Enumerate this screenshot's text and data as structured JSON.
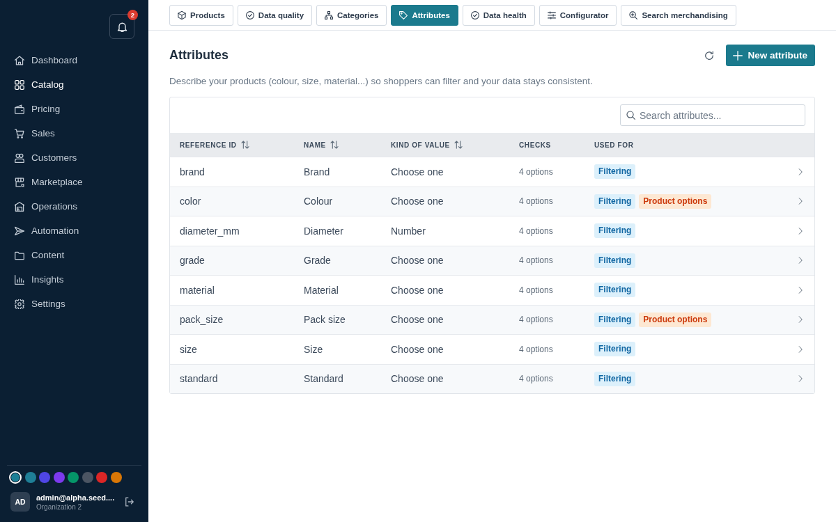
{
  "sidebar": {
    "notifications": {
      "count": "2"
    },
    "nav": [
      {
        "label": "Dashboard",
        "selected": false
      },
      {
        "label": "Catalog",
        "selected": true
      },
      {
        "label": "Pricing",
        "selected": false
      },
      {
        "label": "Sales",
        "selected": false
      },
      {
        "label": "Customers",
        "selected": false
      },
      {
        "label": "Marketplace",
        "selected": false
      },
      {
        "label": "Operations",
        "selected": false
      },
      {
        "label": "Automation",
        "selected": false
      },
      {
        "label": "Content",
        "selected": false
      },
      {
        "label": "Insights",
        "selected": false
      },
      {
        "label": "Settings",
        "selected": false
      }
    ],
    "swatches": [
      {
        "color": "#1d7f96",
        "selected": true
      },
      {
        "color": "#1f7f97",
        "selected": false
      },
      {
        "color": "#4f46e5",
        "selected": false
      },
      {
        "color": "#7c3aed",
        "selected": false
      },
      {
        "color": "#059669",
        "selected": false
      },
      {
        "color": "#4b5563",
        "selected": false
      },
      {
        "color": "#dc2626",
        "selected": false
      },
      {
        "color": "#d97706",
        "selected": false
      }
    ],
    "account": {
      "initials": "AD",
      "email": "admin@alpha.seed....",
      "organization": "Organization 2"
    }
  },
  "tabs": [
    {
      "label": "Products",
      "selected": false
    },
    {
      "label": "Data quality",
      "selected": false
    },
    {
      "label": "Categories",
      "selected": false
    },
    {
      "label": "Attributes",
      "selected": true
    },
    {
      "label": "Data health",
      "selected": false
    },
    {
      "label": "Configurator",
      "selected": false
    },
    {
      "label": "Search merchandising",
      "selected": false
    }
  ],
  "page": {
    "title": "Attributes",
    "new_button": "New attribute",
    "description": "Describe your products (colour, size, material...) so shoppers can filter and your data stays consistent."
  },
  "table": {
    "search": {
      "placeholder": "Search attributes..."
    },
    "columns": [
      {
        "label": "REFERENCE ID",
        "sortable": true
      },
      {
        "label": "NAME",
        "sortable": true
      },
      {
        "label": "KIND OF VALUE",
        "sortable": true
      },
      {
        "label": "CHECKS",
        "sortable": false
      },
      {
        "label": "USED FOR",
        "sortable": false
      }
    ],
    "rows": [
      {
        "reference_id": "brand",
        "name": "Brand",
        "kind_of_value": "Choose one",
        "checks": "4 options",
        "used_for": [
          {
            "label": "Filtering",
            "kind": "filtering"
          }
        ]
      },
      {
        "reference_id": "color",
        "name": "Colour",
        "kind_of_value": "Choose one",
        "checks": "4 options",
        "used_for": [
          {
            "label": "Filtering",
            "kind": "filtering"
          },
          {
            "label": "Product options",
            "kind": "product_options"
          }
        ]
      },
      {
        "reference_id": "diameter_mm",
        "name": "Diameter",
        "kind_of_value": "Number",
        "checks": "4 options",
        "used_for": [
          {
            "label": "Filtering",
            "kind": "filtering"
          }
        ]
      },
      {
        "reference_id": "grade",
        "name": "Grade",
        "kind_of_value": "Choose one",
        "checks": "4 options",
        "used_for": [
          {
            "label": "Filtering",
            "kind": "filtering"
          }
        ]
      },
      {
        "reference_id": "material",
        "name": "Material",
        "kind_of_value": "Choose one",
        "checks": "4 options",
        "used_for": [
          {
            "label": "Filtering",
            "kind": "filtering"
          }
        ]
      },
      {
        "reference_id": "pack_size",
        "name": "Pack size",
        "kind_of_value": "Choose one",
        "checks": "4 options",
        "used_for": [
          {
            "label": "Filtering",
            "kind": "filtering"
          },
          {
            "label": "Product options",
            "kind": "product_options"
          }
        ]
      },
      {
        "reference_id": "size",
        "name": "Size",
        "kind_of_value": "Choose one",
        "checks": "4 options",
        "used_for": [
          {
            "label": "Filtering",
            "kind": "filtering"
          }
        ]
      },
      {
        "reference_id": "standard",
        "name": "Standard",
        "kind_of_value": "Choose one",
        "checks": "4 options",
        "used_for": [
          {
            "label": "Filtering",
            "kind": "filtering"
          }
        ]
      }
    ]
  }
}
